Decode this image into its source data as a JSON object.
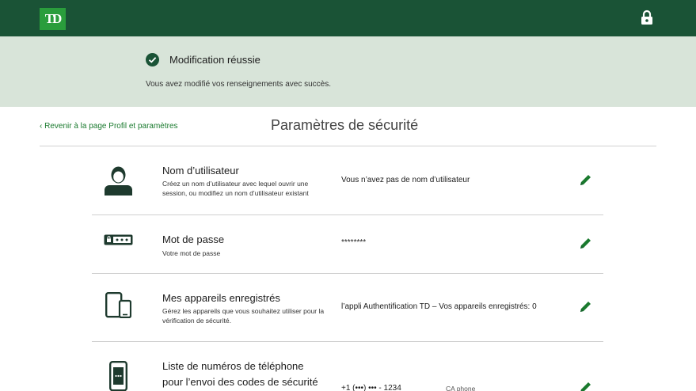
{
  "header": {
    "logo_text": "TD",
    "lock_icon": "lock-icon",
    "bg_color": "#1a5336"
  },
  "banner": {
    "title": "Modification réussie",
    "message": "Vous avez modifié vos renseignements avec succès.",
    "icon": "check-circle-icon",
    "bg_color": "#d8e4d9"
  },
  "nav": {
    "back_link": "‹ Revenir à la page Profil et paramètres"
  },
  "page": {
    "title": "Paramètres de sécurité"
  },
  "settings": [
    {
      "icon": "user-icon",
      "title": "Nom d’utilisateur",
      "desc": "Créez un nom d’utilisateur avec lequel ouvrir une session, ou modifiez un nom d’utilisateur existant",
      "value": "Vous n’avez pas de nom d’utilisateur",
      "action_icon": "pencil-icon"
    },
    {
      "icon": "password-icon",
      "title": "Mot de passe",
      "desc": "Votre mot de passe",
      "value": "********",
      "action_icon": "pencil-icon"
    },
    {
      "icon": "devices-icon",
      "title": "Mes appareils enregistrés",
      "desc": "Gérez les appareils que vous souhaitez utiliser pour la vérification de sécurité.",
      "value": "l’appli Authentification TD – Vos appareils enregistrés: 0",
      "action_icon": "pencil-icon"
    },
    {
      "icon": "phone-icon",
      "title_line1": "Liste de numéros de téléphone",
      "title_line2": "pour l’envoi des codes de sécurité",
      "value": "+1 (•••) ••• - 1234",
      "phone_label": "CA phone",
      "action_icon": "pencil-icon"
    }
  ],
  "accent_color": "#1a7a2e"
}
